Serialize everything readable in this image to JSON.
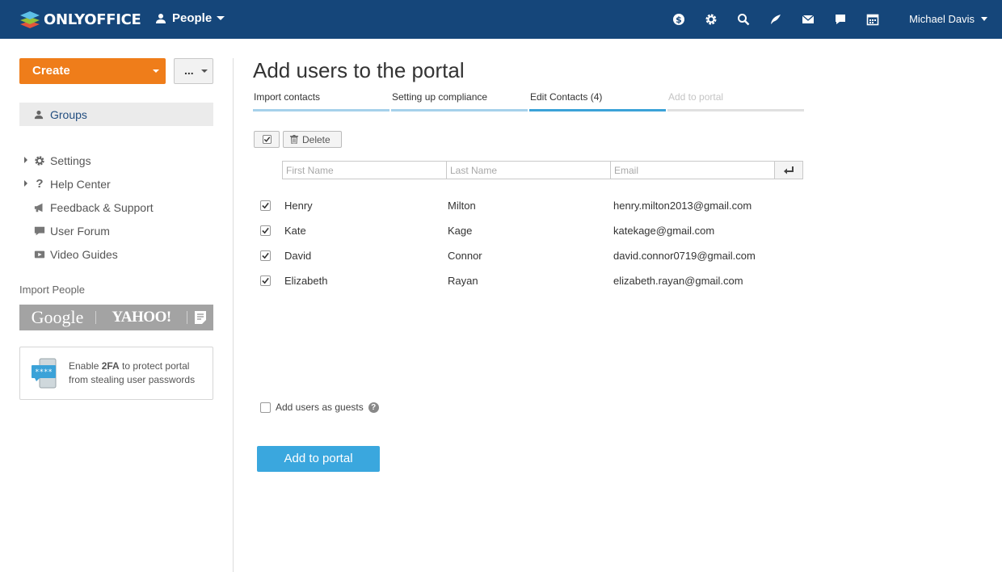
{
  "header": {
    "logo_text": "ONLYOFFICE",
    "module_label": "People",
    "icons": [
      "billing-icon",
      "settings-icon",
      "search-icon",
      "feed-icon",
      "mail-icon",
      "talk-icon",
      "calendar-icon"
    ],
    "user_name": "Michael Davis",
    "bg_color": "#15467a"
  },
  "sidebar": {
    "create_label": "Create",
    "more_label": "...",
    "groups_label": "Groups",
    "menu": [
      {
        "label": "Settings",
        "icon": "gear-icon",
        "expandable": true
      },
      {
        "label": "Help Center",
        "icon": "question-icon",
        "expandable": true
      },
      {
        "label": "Feedback & Support",
        "icon": "megaphone-icon",
        "expandable": false
      },
      {
        "label": "User Forum",
        "icon": "speech-bubble-icon",
        "expandable": false
      },
      {
        "label": "Video Guides",
        "icon": "video-icon",
        "expandable": false
      }
    ],
    "import_title": "Import People",
    "import_google": "Google",
    "import_yahoo": "YAHOO!",
    "tfa_prefix": "Enable ",
    "tfa_bold": "2FA",
    "tfa_suffix": " to protect portal",
    "tfa_line2": "from stealing user passwords",
    "accent_color": "#ef7d1a"
  },
  "main": {
    "title": "Add users to the portal",
    "steps": [
      {
        "label": "Import contacts",
        "state": "done"
      },
      {
        "label": "Setting up compliance",
        "state": "done"
      },
      {
        "label": "Edit Contacts (4)",
        "state": "active"
      },
      {
        "label": "Add to portal",
        "state": "todo"
      }
    ],
    "delete_label": "Delete",
    "first_name_placeholder": "First Name",
    "last_name_placeholder": "Last Name",
    "email_placeholder": "Email",
    "contacts": [
      {
        "first": "Henry",
        "last": "Milton",
        "email": "henry.milton2013@gmail.com",
        "checked": true
      },
      {
        "first": "Kate",
        "last": "Kage",
        "email": "katekage@gmail.com",
        "checked": true
      },
      {
        "first": "David",
        "last": "Connor",
        "email": "david.connor0719@gmail.com",
        "checked": true
      },
      {
        "first": "Elizabeth",
        "last": "Rayan",
        "email": "elizabeth.rayan@gmail.com",
        "checked": true
      }
    ],
    "guests_label": "Add users as guests",
    "add_button_label": "Add to portal",
    "button_color": "#3aa7de"
  }
}
